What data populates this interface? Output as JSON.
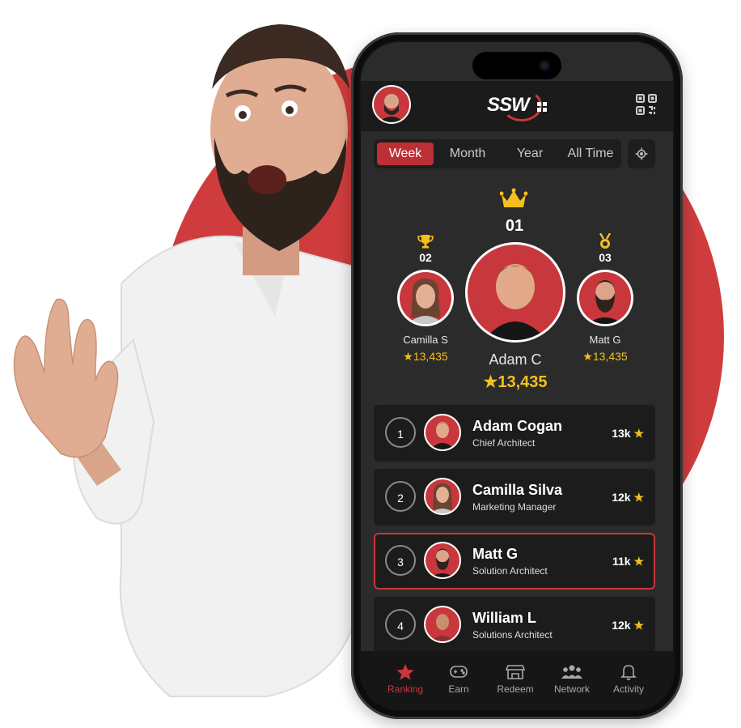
{
  "app": {
    "logo_text": "SSW",
    "brand_color": "#c8373b",
    "accent_star_color": "#f4c01e"
  },
  "tabs": [
    {
      "label": "Week",
      "active": true
    },
    {
      "label": "Month",
      "active": false
    },
    {
      "label": "Year",
      "active": false
    },
    {
      "label": "All Time",
      "active": false
    }
  ],
  "podium": {
    "first": {
      "rank": "01",
      "name": "Adam C",
      "points": "13,435"
    },
    "second": {
      "rank": "02",
      "name": "Camilla S",
      "points": "13,435"
    },
    "third": {
      "rank": "03",
      "name": "Matt G",
      "points": "13,435"
    }
  },
  "leaderboard": [
    {
      "rank": "1",
      "name": "Adam Cogan",
      "role": "Chief Architect",
      "points": "13k",
      "highlighted": false
    },
    {
      "rank": "2",
      "name": "Camilla Silva",
      "role": "Marketing Manager",
      "points": "12k",
      "highlighted": false
    },
    {
      "rank": "3",
      "name": "Matt G",
      "role": "Solution Architect",
      "points": "11k",
      "highlighted": true
    },
    {
      "rank": "4",
      "name": "William L",
      "role": "Solutions Architect",
      "points": "12k",
      "highlighted": false
    }
  ],
  "bottom_nav": [
    {
      "label": "Ranking",
      "icon": "star-icon",
      "active": true
    },
    {
      "label": "Earn",
      "icon": "gamepad-icon",
      "active": false
    },
    {
      "label": "Redeem",
      "icon": "store-icon",
      "active": false
    },
    {
      "label": "Network",
      "icon": "people-icon",
      "active": false
    },
    {
      "label": "Activity",
      "icon": "bell-icon",
      "active": false
    }
  ]
}
